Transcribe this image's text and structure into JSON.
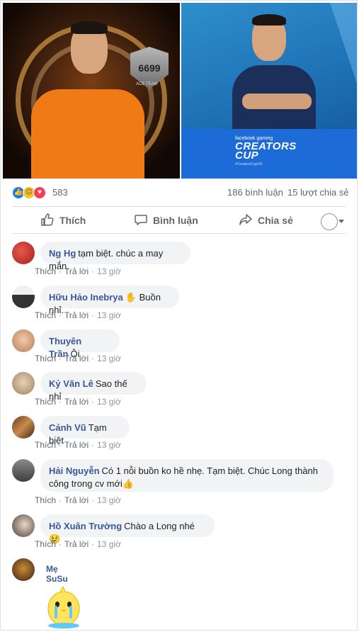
{
  "post": {
    "reaction_count": "583",
    "comments_count": "186 bình luận",
    "shares_count": "15 lượt chia sẻ",
    "photo_right": {
      "brand": "facebook gaming",
      "title_line1": "CREATORS",
      "title_line2": "CUP",
      "hashtag": "#CreatorsCupVN"
    },
    "photo_left": {
      "badge": "6699",
      "badge_sub": "ACE TEAM"
    }
  },
  "actions": {
    "like": "Thích",
    "comment": "Bình luận",
    "share": "Chia sẻ"
  },
  "meta": {
    "like": "Thích",
    "reply": "Trả lời",
    "dot": "·"
  },
  "comments": [
    {
      "name": "Ng Hg",
      "text": "tạm biệt. chúc a may mắn.",
      "time": "13 giờ"
    },
    {
      "name": "Hữu Hảo Inebrya",
      "text": "✋ Buồn nhỉ.",
      "time": "13 giờ"
    },
    {
      "name": "Thuyên Trần",
      "text": "Ôi",
      "time": "13 giờ"
    },
    {
      "name": "Kỷ Văn Lê",
      "text": "Sao thế nhỉ",
      "time": "13 giờ"
    },
    {
      "name": "Cảnh Vũ",
      "text": "Tạm biệt",
      "time": "13 giờ"
    },
    {
      "name": "Hải Nguyễn",
      "text": "Có 1 nỗi buồn ko hề nhẹ. Tạm biệt. Chúc Long thành công trong cv mới👍",
      "time": "13 giờ"
    },
    {
      "name": "Hồ Xuân Trường",
      "text": "Chào a Long nhé 😢",
      "time": "13 giờ"
    },
    {
      "name": "Mẹ SuSu",
      "text": "",
      "time": ""
    }
  ],
  "colors": {
    "link_name": "#385898",
    "like_blue": "#1877f2",
    "love_red": "#f33e58",
    "sad_yellow": "#f7c531",
    "bubble_bg": "#f2f3f5"
  },
  "icons": {
    "like": "thumbs-up-icon",
    "comment": "speech-bubble-icon",
    "share": "share-arrow-icon",
    "reaction_like": "like-reaction-icon",
    "reaction_sad": "sad-reaction-icon",
    "reaction_love": "love-reaction-icon"
  }
}
